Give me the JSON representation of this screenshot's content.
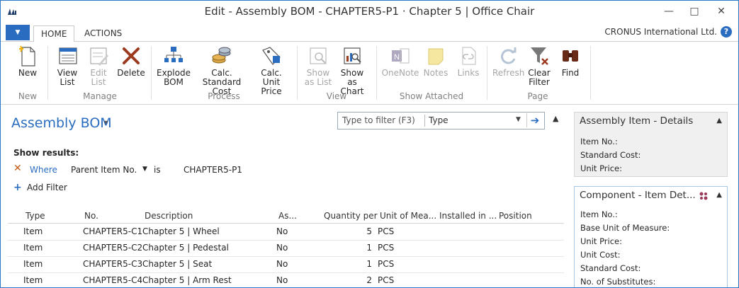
{
  "window": {
    "title": "Edit - Assembly BOM - CHAPTER5-P1 · Chapter 5 | Office Chair",
    "minimize": "—",
    "maximize": "□",
    "close": "✕"
  },
  "tabs": [
    "HOME",
    "ACTIONS"
  ],
  "app_menu": "▼",
  "company": "CRONUS International Ltd.",
  "help": "?",
  "ribbon": {
    "new": "New",
    "view_list": "View List",
    "edit_list": "Edit List",
    "delete": "Delete",
    "explode_bom": "Explode BOM",
    "calc_standard_cost": "Calc. Standard Cost",
    "calc_unit_price": "Calc. Unit Price",
    "show_as_list": "Show as List",
    "show_as_chart": "Show as Chart",
    "onenote": "OneNote",
    "notes": "Notes",
    "links": "Links",
    "refresh": "Refresh",
    "clear_filter": "Clear Filter",
    "find": "Find",
    "groups": {
      "new": "New",
      "manage": "Manage",
      "process": "Process",
      "view": "View",
      "show_attached": "Show Attached",
      "page": "Page"
    }
  },
  "page": {
    "title": "Assembly BOM",
    "filter_placeholder": "Type to filter (F3)",
    "filter_field": "Type",
    "show_results": "Show results:",
    "where": "Where",
    "filter_field_name": "Parent Item No.",
    "filter_op": "is",
    "filter_value": "CHAPTER5-P1",
    "add_filter": "Add Filter"
  },
  "table": {
    "columns": [
      "Type",
      "No.",
      "Description",
      "As...",
      "Quantity per",
      "Unit of Mea...",
      "Installed in ...",
      "Position"
    ],
    "rows": [
      {
        "type": "Item",
        "no": "CHAPTER5-C1",
        "description": "Chapter 5 | Wheel",
        "as": "No",
        "qty": "5",
        "uom": "PCS"
      },
      {
        "type": "Item",
        "no": "CHAPTER5-C2",
        "description": "Chapter 5 | Pedestal",
        "as": "No",
        "qty": "1",
        "uom": "PCS"
      },
      {
        "type": "Item",
        "no": "CHAPTER5-C3",
        "description": "Chapter 5 | Seat",
        "as": "No",
        "qty": "1",
        "uom": "PCS"
      },
      {
        "type": "Item",
        "no": "CHAPTER5-C4",
        "description": "Chapter 5 | Arm Rest",
        "as": "No",
        "qty": "2",
        "uom": "PCS"
      }
    ]
  },
  "factbox1": {
    "title": "Assembly Item - Details",
    "fields": [
      "Item No.:",
      "Standard Cost:",
      "Unit Price:"
    ]
  },
  "factbox2": {
    "title": "Component - Item Det...",
    "fields": [
      "Item No.:",
      "Base Unit of Measure:",
      "Unit Price:",
      "Unit Cost:",
      "Standard Cost:",
      "No. of Substitutes:"
    ]
  }
}
